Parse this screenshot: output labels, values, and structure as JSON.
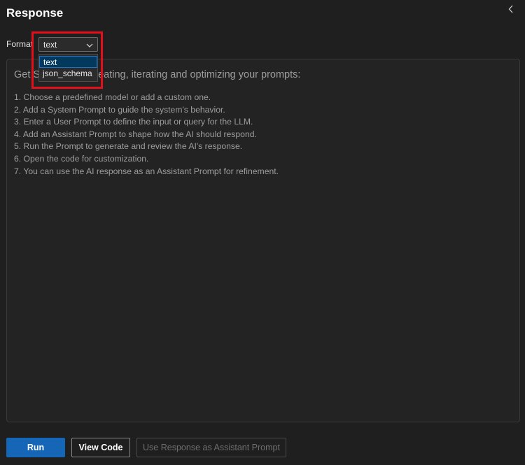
{
  "panel": {
    "title": "Response",
    "collapse_icon": "chevron-left-icon"
  },
  "format": {
    "label": "Format",
    "selected": "text",
    "options": [
      "text",
      "json_schema"
    ],
    "highlight_color": "#e3101c"
  },
  "response": {
    "intro": "Get Started with creating, iterating and optimizing your prompts:",
    "steps": [
      "1. Choose a predefined model or add a custom one.",
      "2. Add a System Prompt to guide the system's behavior.",
      "3. Enter a User Prompt to define the input or query for the LLM.",
      "4. Add an Assistant Prompt to shape how the AI should respond.",
      "5. Run the Prompt to generate and review the AI's response.",
      "6. Open the code for customization.",
      "7. You can use the AI response as an Assistant Prompt for refinement."
    ]
  },
  "footer": {
    "run_label": "Run",
    "view_code_label": "View Code",
    "use_response_label": "Use Response as Assistant Prompt"
  },
  "colors": {
    "accent": "#1566b7",
    "background": "#1f1f1f",
    "selected_option": "#04395e"
  }
}
